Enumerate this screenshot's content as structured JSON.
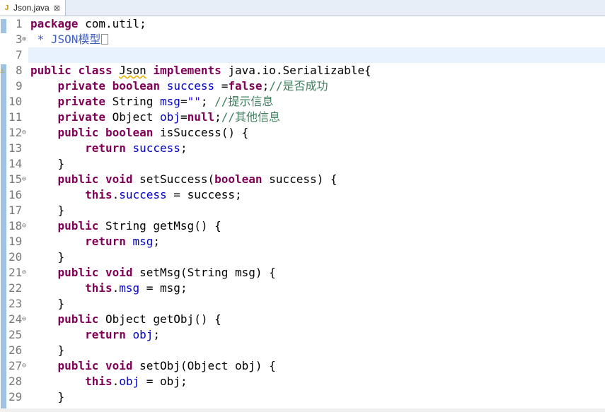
{
  "tab": {
    "title": "Json.java",
    "file_icon": "java-file-icon",
    "close_glyph": "⊠"
  },
  "gutter": {
    "line_numbers": [
      "1",
      "3",
      "7",
      "8",
      "9",
      "10",
      "11",
      "12",
      "13",
      "14",
      "15",
      "16",
      "17",
      "18",
      "19",
      "20",
      "21",
      "22",
      "23",
      "24",
      "25",
      "26",
      "27",
      "28",
      "29"
    ],
    "folded_marker": "⊕",
    "expanded_marker": "⊖"
  },
  "code": {
    "l1_kw": "package",
    "l1_rest": " com.util;",
    "l3_comment": " * JSON模型",
    "l8": {
      "kw1": "public",
      "kw2": "class",
      "name": "Json",
      "kw3": "implements",
      "rest": " java.io.Serializable{"
    },
    "l9": {
      "kw1": "private",
      "kw2": "boolean",
      "field": "success",
      "eq": " =",
      "val": "false",
      "semi": ";",
      "comment": "//是否成功"
    },
    "l10": {
      "kw1": "private",
      "type": " String ",
      "field": "msg",
      "eq": "=",
      "str": "\"\"",
      "semi": "; ",
      "comment": "//提示信息"
    },
    "l11": {
      "kw1": "private",
      "type": " Object ",
      "field": "obj",
      "eq": "=",
      "val": "null",
      "semi": ";",
      "comment": "//其他信息"
    },
    "l12": {
      "kw1": "public",
      "kw2": "boolean",
      "rest": " isSuccess() {"
    },
    "l13": {
      "kw": "return",
      "field": "success",
      "semi": ";"
    },
    "l14": "}",
    "l15": {
      "kw1": "public",
      "kw2": "void",
      "mid": " setSuccess(",
      "kw3": "boolean",
      "rest": " success) {"
    },
    "l16": {
      "kw": "this",
      "dot": ".",
      "field": "success",
      "rest": " = success;"
    },
    "l17": "}",
    "l18": {
      "kw1": "public",
      "rest": " String getMsg() {"
    },
    "l19": {
      "kw": "return",
      "field": "msg",
      "semi": ";"
    },
    "l20": "}",
    "l21": {
      "kw1": "public",
      "kw2": "void",
      "rest": " setMsg(String msg) {"
    },
    "l22": {
      "kw": "this",
      "dot": ".",
      "field": "msg",
      "rest": " = msg;"
    },
    "l23": "}",
    "l24": {
      "kw1": "public",
      "rest": " Object getObj() {"
    },
    "l25": {
      "kw": "return",
      "field": "obj",
      "semi": ";"
    },
    "l26": "}",
    "l27": {
      "kw1": "public",
      "kw2": "void",
      "rest": " setObj(Object obj) {"
    },
    "l28": {
      "kw": "this",
      "dot": ".",
      "field": "obj",
      "rest": " = obj;"
    },
    "l29": "}"
  },
  "colors": {
    "keyword": "#7f0055",
    "field": "#0000c0",
    "comment": "#3f7f5f",
    "string": "#2a00ff",
    "javadoc": "#3f5fbf",
    "current_line": "#e8f2fe"
  }
}
